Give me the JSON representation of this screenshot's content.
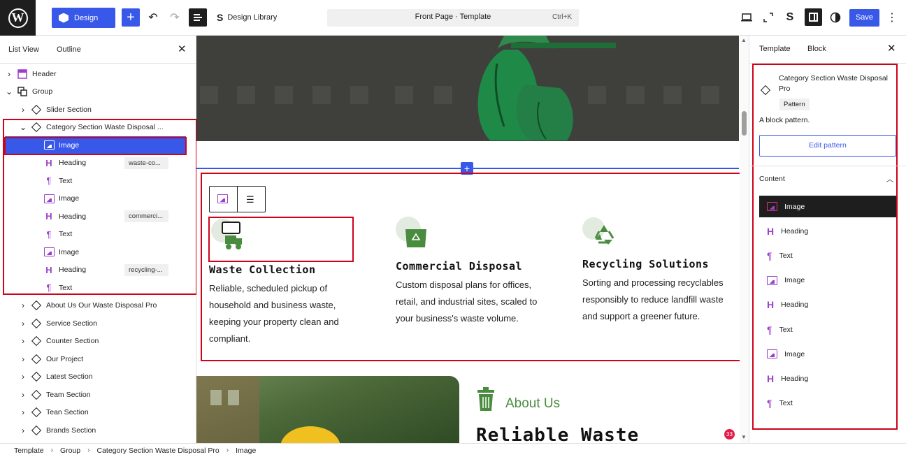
{
  "topbar": {
    "design_label": "Design",
    "design_library_label": "Design Library",
    "command_bar_text": "Front Page · Template",
    "command_shortcut": "Ctrl+K",
    "save_label": "Save"
  },
  "left_panel": {
    "tabs": [
      "List View",
      "Outline"
    ],
    "tree": [
      {
        "label": "Header",
        "icon": "template-part-icon",
        "depth": 0,
        "chevron": "right"
      },
      {
        "label": "Group",
        "icon": "group-icon",
        "depth": 0,
        "chevron": "down"
      },
      {
        "label": "Slider Section",
        "icon": "pattern-icon",
        "depth": 1,
        "chevron": "right"
      },
      {
        "label": "Category Section Waste Disposal ...",
        "icon": "pattern-icon",
        "depth": 1,
        "chevron": "down"
      },
      {
        "label": "Image",
        "icon": "image-icon",
        "depth": 2,
        "selected": true
      },
      {
        "label": "Heading",
        "icon": "heading-icon",
        "depth": 2,
        "badge": "waste-co..."
      },
      {
        "label": "Text",
        "icon": "paragraph-icon",
        "depth": 2
      },
      {
        "label": "Image",
        "icon": "image-icon",
        "depth": 2
      },
      {
        "label": "Heading",
        "icon": "heading-icon",
        "depth": 2,
        "badge": "commerci..."
      },
      {
        "label": "Text",
        "icon": "paragraph-icon",
        "depth": 2
      },
      {
        "label": "Image",
        "icon": "image-icon",
        "depth": 2
      },
      {
        "label": "Heading",
        "icon": "heading-icon",
        "depth": 2,
        "badge": "recycling-..."
      },
      {
        "label": "Text",
        "icon": "paragraph-icon",
        "depth": 2
      },
      {
        "label": "About Us Our Waste Disposal Pro",
        "icon": "pattern-icon",
        "depth": 1,
        "chevron": "right"
      },
      {
        "label": "Service Section",
        "icon": "pattern-icon",
        "depth": 1,
        "chevron": "right"
      },
      {
        "label": "Counter Section",
        "icon": "pattern-icon",
        "depth": 1,
        "chevron": "right"
      },
      {
        "label": "Our Project",
        "icon": "pattern-icon",
        "depth": 1,
        "chevron": "right"
      },
      {
        "label": "Latest Section",
        "icon": "pattern-icon",
        "depth": 1,
        "chevron": "right"
      },
      {
        "label": "Team Section",
        "icon": "pattern-icon",
        "depth": 1,
        "chevron": "right"
      },
      {
        "label": "Tean Section",
        "icon": "pattern-icon",
        "depth": 1,
        "chevron": "right"
      },
      {
        "label": "Brands Section",
        "icon": "pattern-icon",
        "depth": 1,
        "chevron": "right"
      }
    ]
  },
  "canvas": {
    "columns": [
      {
        "title": "Waste Collection",
        "text": "Reliable, scheduled pickup of household and business waste, keeping your property clean and compliant.",
        "icon": "garbage-truck-icon"
      },
      {
        "title": "Commercial Disposal",
        "text": "Custom disposal plans for offices, retail, and industrial sites, scaled to your business's waste volume.",
        "icon": "dumpster-recycle-icon"
      },
      {
        "title": "Recycling Solutions",
        "text": "Sorting and processing recyclables responsibly to reduce landfill waste and support a greener future.",
        "icon": "recycle-icon"
      }
    ],
    "about_label": "About Us",
    "about_heading": "Reliable Waste",
    "notification_count": "33"
  },
  "right_panel": {
    "tabs": [
      "Template",
      "Block"
    ],
    "block_title": "Category Section Waste Disposal Pro",
    "block_badge": "Pattern",
    "block_description": "A block pattern.",
    "edit_button": "Edit pattern",
    "content_label": "Content",
    "content_items": [
      {
        "label": "Image",
        "icon": "image-icon",
        "active": true
      },
      {
        "label": "Heading",
        "icon": "heading-icon"
      },
      {
        "label": "Text",
        "icon": "paragraph-icon"
      },
      {
        "label": "Image",
        "icon": "image-icon"
      },
      {
        "label": "Heading",
        "icon": "heading-icon"
      },
      {
        "label": "Text",
        "icon": "paragraph-icon"
      },
      {
        "label": "Image",
        "icon": "image-icon"
      },
      {
        "label": "Heading",
        "icon": "heading-icon"
      },
      {
        "label": "Text",
        "icon": "paragraph-icon"
      }
    ]
  },
  "breadcrumb": [
    "Template",
    "Group",
    "Category Section Waste Disposal Pro",
    "Image"
  ],
  "colors": {
    "accent": "#3858e9",
    "selection_outline": "#d0021b",
    "brand_green": "#4a8c3f",
    "block_icon": "#9b3fc8"
  }
}
